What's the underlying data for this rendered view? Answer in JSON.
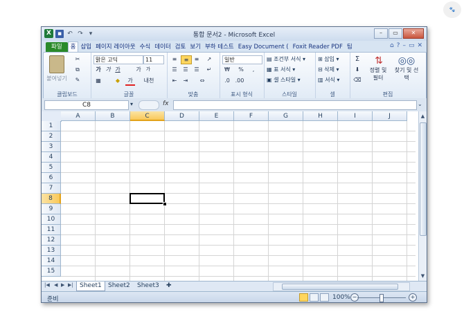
{
  "window": {
    "title": "통합 문서2 - Microsoft Excel",
    "app_icon": "X",
    "qat_undo": "↶",
    "qat_redo": "↷",
    "minimize": "–",
    "maximize": "▭",
    "close": "✕"
  },
  "tabs": [
    "파일",
    "홈",
    "삽입",
    "페이지 레이아웃",
    "수식",
    "데이터",
    "검토",
    "보기",
    "부하 테스트",
    "Easy Document (",
    "Foxit Reader PDF",
    "팀"
  ],
  "ribbon": {
    "clipboard": {
      "label": "클립보드",
      "paste": "붙여넣기"
    },
    "font": {
      "label": "글꼴",
      "name": "맑은 고딕",
      "size": "11",
      "bold": "가",
      "italic": "가",
      "underline": "가",
      "grow": "가",
      "shrink": "가",
      "color": "가",
      "phonetic": "내천"
    },
    "alignment": {
      "label": "맞춤"
    },
    "number": {
      "label": "표시 형식",
      "format": "일반",
      "percent": "%",
      "comma": ","
    },
    "styles": {
      "label": "스타일",
      "conditional": "조건부 서식",
      "table": "표 서식",
      "cell": "셀 스타일"
    },
    "cells": {
      "label": "셀",
      "insert": "삽입",
      "delete": "삭제",
      "format": "서식"
    },
    "editing": {
      "label": "편집",
      "sum": "Σ",
      "sort": "정렬 및 필터",
      "find": "찾기 및 선택"
    }
  },
  "formula_bar": {
    "name_box": "C8",
    "fx": "fx",
    "value": ""
  },
  "grid": {
    "columns": [
      "A",
      "B",
      "C",
      "D",
      "E",
      "F",
      "G",
      "H",
      "I",
      "J"
    ],
    "rows": [
      "1",
      "2",
      "3",
      "4",
      "5",
      "6",
      "7",
      "8",
      "9",
      "10",
      "11",
      "12",
      "13",
      "14",
      "15"
    ],
    "selected_column": "C",
    "selected_row": "8"
  },
  "sheets": [
    "Sheet1",
    "Sheet2",
    "Sheet3"
  ],
  "status": {
    "text": "준비",
    "zoom": "100%",
    "zoom_minus": "−",
    "zoom_plus": "+"
  }
}
